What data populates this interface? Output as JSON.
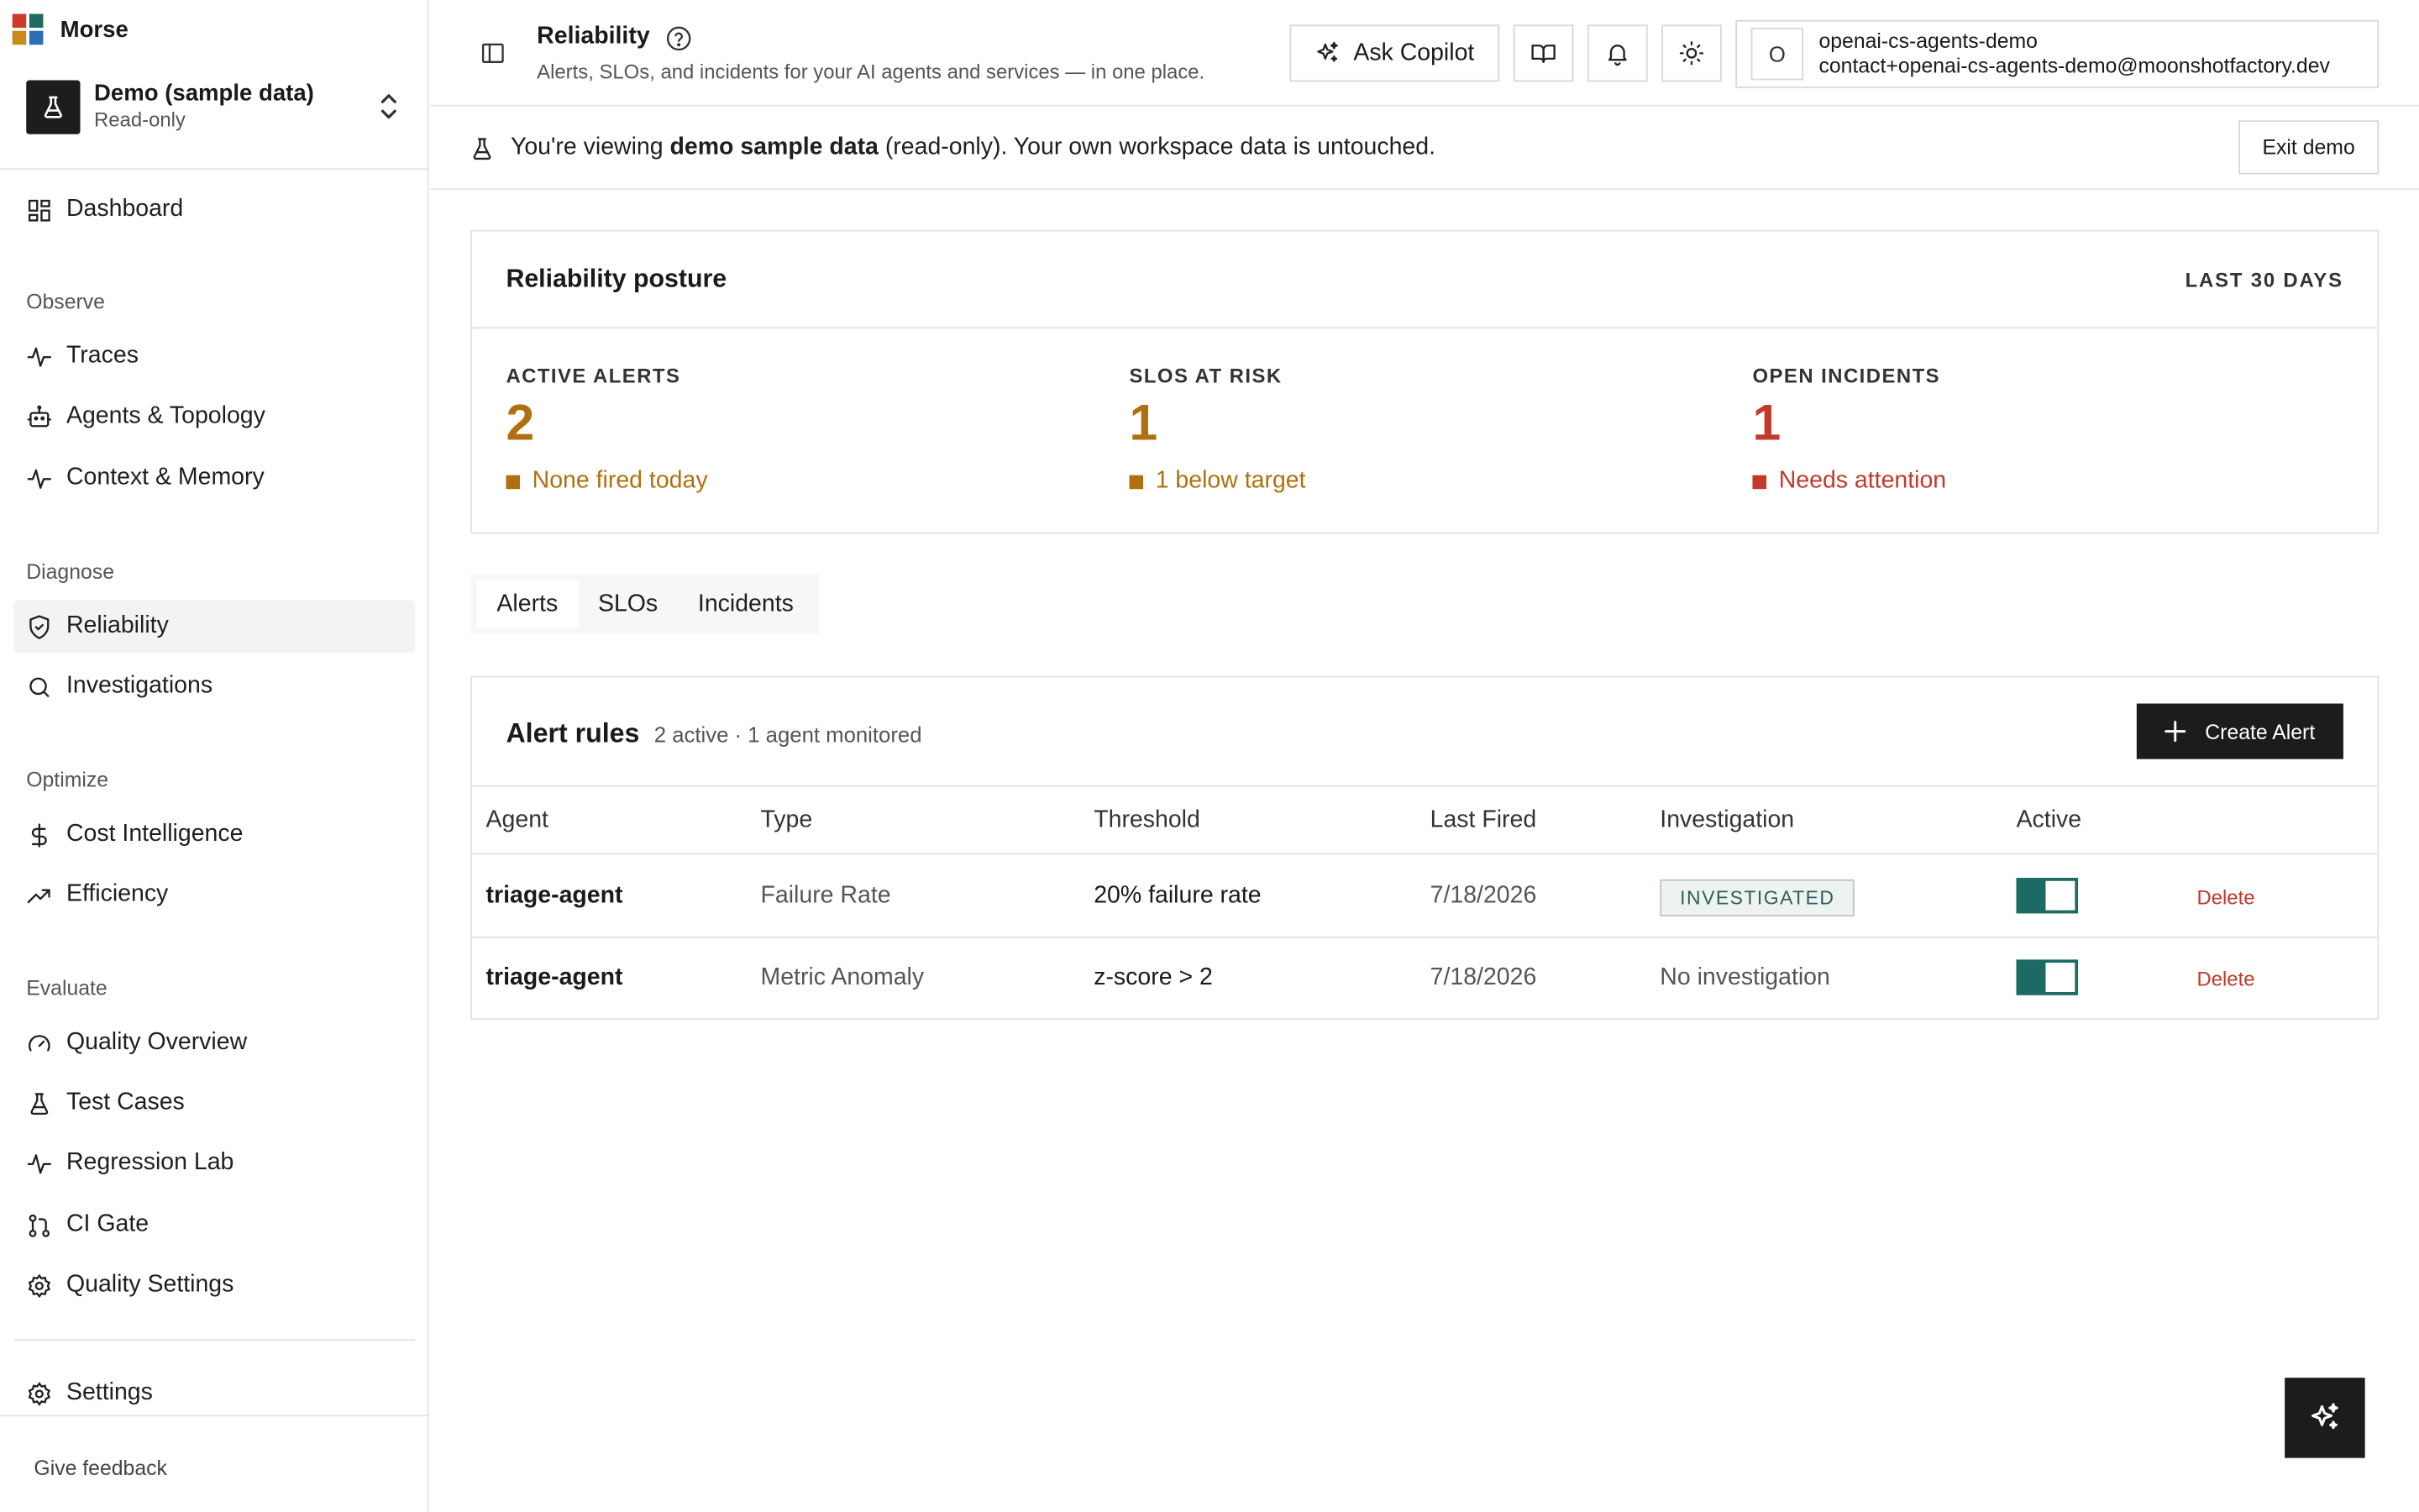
{
  "brand": {
    "name": "Morse",
    "logo_colors": [
      "#d13a2a",
      "#1f6b63",
      "#c98a1a",
      "#2a6fb5"
    ]
  },
  "workspace": {
    "name": "Demo (sample data)",
    "subtitle": "Read-only"
  },
  "sidebar": {
    "dashboard": "Dashboard",
    "sections": {
      "observe": "Observe",
      "diagnose": "Diagnose",
      "optimize": "Optimize",
      "evaluate": "Evaluate"
    },
    "items": {
      "traces": "Traces",
      "agents_topology": "Agents & Topology",
      "context_memory": "Context & Memory",
      "reliability": "Reliability",
      "investigations": "Investigations",
      "cost_intelligence": "Cost Intelligence",
      "efficiency": "Efficiency",
      "quality_overview": "Quality Overview",
      "test_cases": "Test Cases",
      "regression_lab": "Regression Lab",
      "ci_gate": "CI Gate",
      "quality_settings": "Quality Settings",
      "settings": "Settings"
    },
    "active_item": "reliability",
    "feedback": "Give feedback"
  },
  "header": {
    "title": "Reliability",
    "subtitle": "Alerts, SLOs, and incidents for your AI agents and services — in one place.",
    "ask_copilot": "Ask Copilot",
    "account": {
      "initial": "O",
      "org": "openai-cs-agents-demo",
      "email": "contact+openai-cs-agents-demo@moonshotfactory.dev"
    }
  },
  "banner": {
    "prefix": "You're viewing ",
    "bold": "demo sample data",
    "suffix": " (read-only). Your own workspace data is untouched.",
    "exit_label": "Exit demo"
  },
  "posture": {
    "title": "Reliability posture",
    "range": "LAST 30 DAYS",
    "metrics": [
      {
        "label": "ACTIVE ALERTS",
        "value": "2",
        "note": "None fired today",
        "color": "#b0700f"
      },
      {
        "label": "SLOS AT RISK",
        "value": "1",
        "note": "1 below target",
        "color": "#b0700f"
      },
      {
        "label": "OPEN INCIDENTS",
        "value": "1",
        "note": "Needs attention",
        "color": "#c23a2b"
      }
    ]
  },
  "tabs": [
    "Alerts",
    "SLOs",
    "Incidents"
  ],
  "active_tab": "Alerts",
  "alert_rules": {
    "title": "Alert rules",
    "summary": "2 active · 1 agent monitored",
    "create_label": "Create Alert",
    "columns": [
      "Agent",
      "Type",
      "Threshold",
      "Last Fired",
      "Investigation",
      "Active"
    ],
    "rows": [
      {
        "agent": "triage-agent",
        "type": "Failure Rate",
        "threshold": "20% failure rate",
        "last_fired": "7/18/2026",
        "investigation": "INVESTIGATED",
        "investigation_is_badge": true,
        "active": true,
        "delete": "Delete"
      },
      {
        "agent": "triage-agent",
        "type": "Metric Anomaly",
        "threshold": "z-score > 2",
        "last_fired": "7/18/2026",
        "investigation": "No investigation",
        "investigation_is_badge": false,
        "active": true,
        "delete": "Delete"
      }
    ]
  },
  "colors": {
    "accent_teal": "#1d6a63",
    "warning": "#b0700f",
    "danger": "#c23a2b"
  }
}
